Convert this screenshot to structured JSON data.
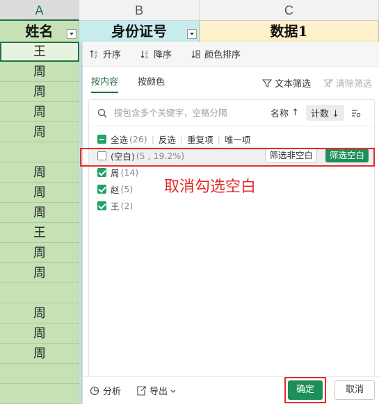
{
  "columns": [
    "A",
    "B",
    "C"
  ],
  "headers": {
    "a": "姓名",
    "b": "身份证号",
    "c": "数据1"
  },
  "col_a_cells": [
    "王",
    "周",
    "周",
    "周",
    "周",
    "",
    "周",
    "周",
    "周",
    "王",
    "周",
    "周",
    "",
    "周",
    "周",
    "周",
    "",
    ""
  ],
  "sortbar": {
    "asc": "升序",
    "desc": "降序",
    "color_sort": "颜色排序"
  },
  "tabs": {
    "by_content": "按内容",
    "by_color": "按颜色"
  },
  "filter_actions": {
    "text_filter": "文本筛选",
    "clear_filter": "清除筛选"
  },
  "search": {
    "placeholder": "搜包含多个关键字，空格分隔"
  },
  "list_controls": {
    "sort_name": "名称",
    "sort_name_arrow": "↑",
    "sort_count": "计数",
    "sort_count_arrow": "↓"
  },
  "select_all": {
    "label": "全选",
    "count": "(26)",
    "invert": "反选",
    "duplicates": "重复项",
    "unique": "唯一项"
  },
  "items": [
    {
      "label": "(空白)",
      "count": "(5 , 19.2%)",
      "checked": false
    },
    {
      "label": "周",
      "count": "(14)",
      "checked": true
    },
    {
      "label": "赵",
      "count": "(5)",
      "checked": true
    },
    {
      "label": "王",
      "count": "(2)",
      "checked": true
    }
  ],
  "blank_buttons": {
    "nonblank": "筛选非空白",
    "blank": "筛选空白"
  },
  "annotation": "取消勾选空白",
  "footer": {
    "analysis": "分析",
    "export": "导出",
    "ok": "确定",
    "cancel": "取消"
  },
  "colors": {
    "accent": "#1e8e5a",
    "highlight_red": "#e52b2b",
    "col_a_fill": "#c6e1b5",
    "col_b_fill": "#c8ecee",
    "col_c_fill": "#fdf1cc"
  }
}
